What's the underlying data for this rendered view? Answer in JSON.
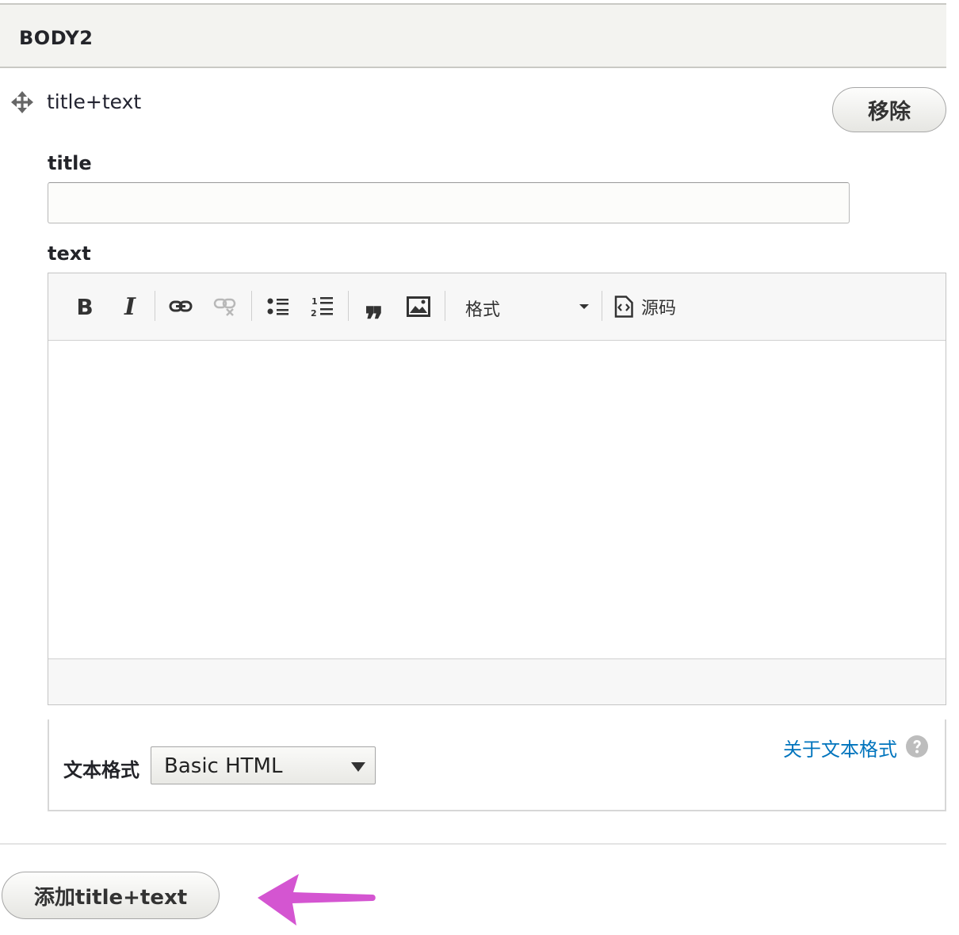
{
  "fieldset": {
    "title": "BODY2"
  },
  "paragraph": {
    "type_label": "title+text",
    "remove_label": "移除"
  },
  "title_field": {
    "label": "title",
    "value": ""
  },
  "text_field": {
    "label": "text",
    "toolbar": {
      "bold_label": "B",
      "italic_label": "I",
      "blockquote_label": "❞",
      "format_label": "格式",
      "source_label": "源码",
      "icons": [
        "bold-icon",
        "italic-icon",
        "link-icon",
        "unlink-icon",
        "bulleted-list-icon",
        "numbered-list-icon",
        "blockquote-icon",
        "image-icon",
        "format-dropdown",
        "source-icon"
      ]
    },
    "content": ""
  },
  "text_format": {
    "label": "文本格式",
    "selected": "Basic HTML",
    "about_link": "关于文本格式"
  },
  "actions": {
    "add_label": "添加title+text"
  },
  "colors": {
    "link": "#0074bd",
    "arrow": "#d455d1",
    "header_bg": "#f3f3f0"
  }
}
